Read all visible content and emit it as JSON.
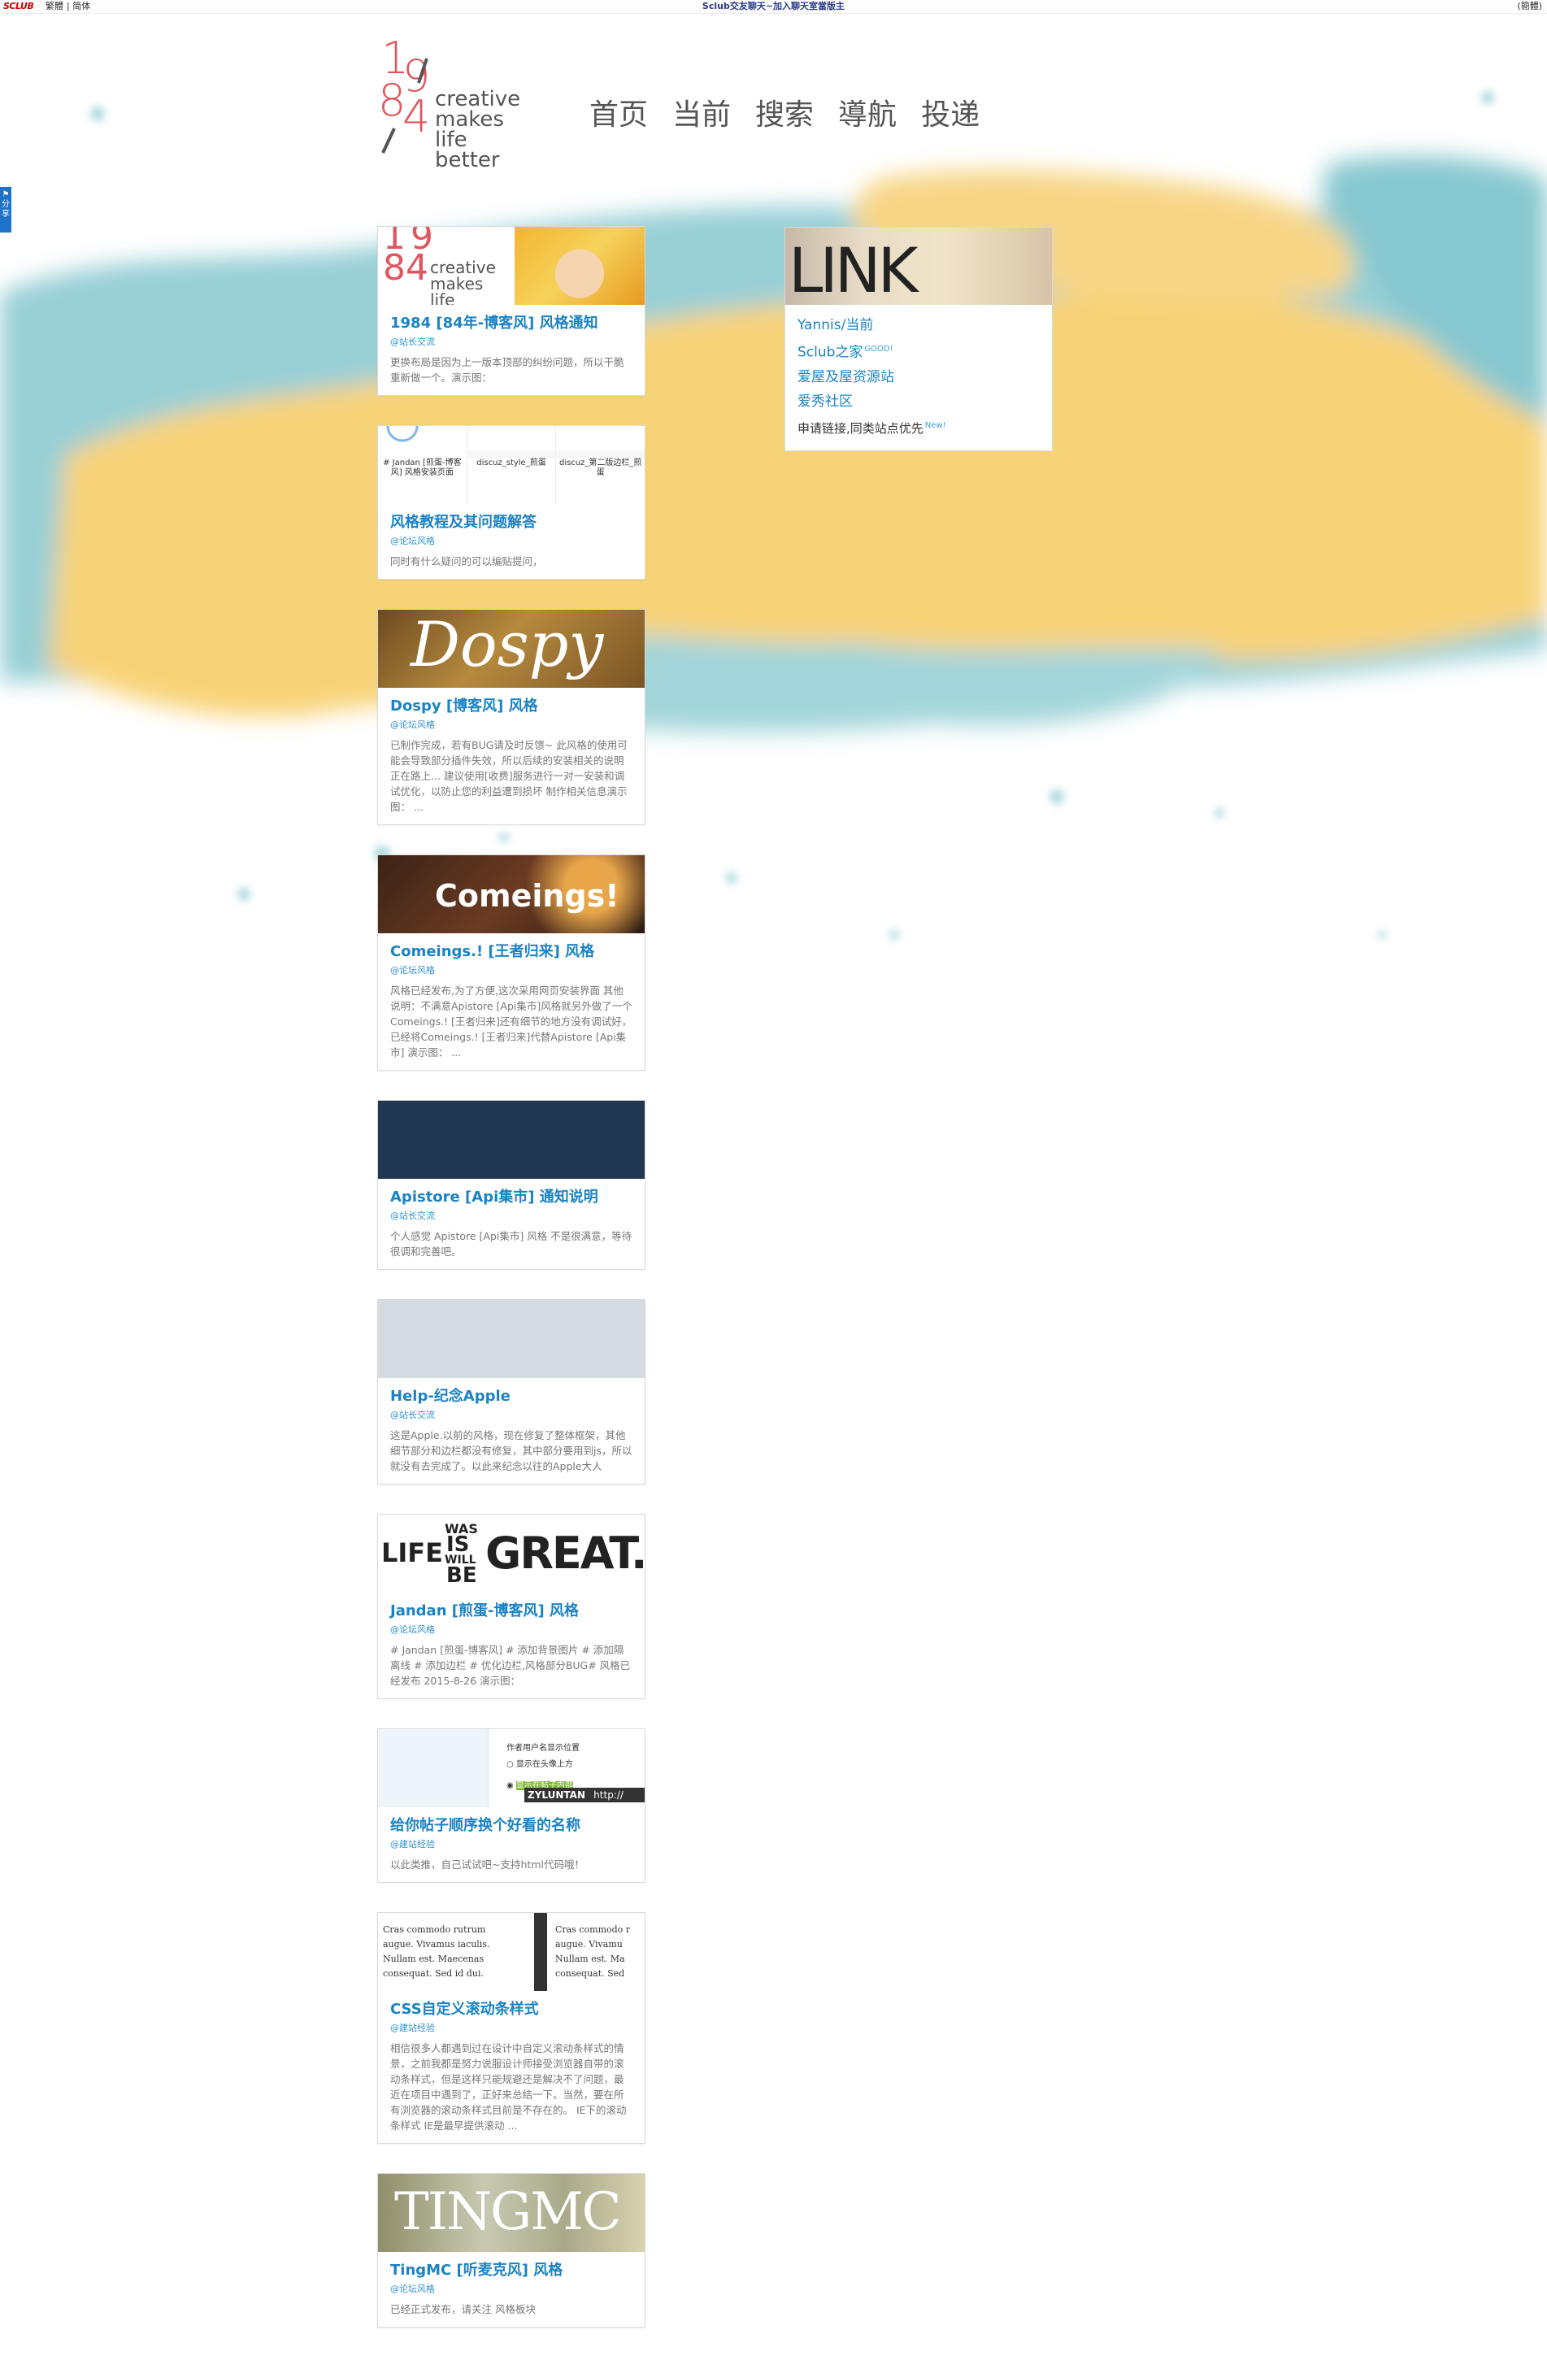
{
  "topbar": {
    "brand": "SCLUB",
    "lang_traditional": "繁體",
    "lang_simplified": "简体",
    "notice": "Sclub交友聊天~加入聊天室當版主",
    "right": "(簡體)"
  },
  "share": {
    "label": "分享"
  },
  "logo": {
    "digits": [
      "1",
      "9",
      "8",
      "4"
    ],
    "tagline": [
      "creative",
      "makes",
      "life",
      "better"
    ]
  },
  "nav": [
    "首页",
    "当前",
    "搜索",
    "導航",
    "投递"
  ],
  "cards": [
    {
      "thumb": "1984",
      "title": "1984 [84年-博客风] 风格通知",
      "category": "@站长交流",
      "desc": "更换布局是因为上一版本顶部的纠纷问题，所以干脆重新做一个。演示图："
    },
    {
      "thumb": "gallery",
      "gallery_items": [
        "# Jandan [煎蛋-博客风] 风格安装页面",
        "discuz_style_煎蛋",
        "discuz_第二版边栏_煎蛋"
      ],
      "title": "风格教程及其问题解答",
      "category": "@论坛风格",
      "desc": "同时有什么疑问的可以编贴提问，"
    },
    {
      "thumb": "dospy",
      "thumb_text": "Dospy",
      "title": "Dospy [博客风] 风格",
      "category": "@论坛风格",
      "desc": "已制作完成，若有BUG请及时反馈~ 此风格的使用可能会导致部分插件失效，所以后续的安装相关的说明正在路上... 建议使用[收费]服务进行一对一安装和调试优化，以防止您的利益遭到损坏 制作相关信息演示图： ..."
    },
    {
      "thumb": "comeings",
      "thumb_text": "Comeings!",
      "title": "Comeings.! [王者归来] 风格",
      "category": "@论坛风格",
      "desc": "风格已经发布,为了方便,这次采用网页安装界面 其他说明：不满意Apistore [Api集市]风格就另外做了一个Comeings.! [王者归来]还有细节的地方没有调试好，已经将Comeings.! [王者归来]代替Apistore [Api集市] 演示图： ..."
    },
    {
      "thumb": "navy",
      "title": "Apistore [Api集市] 通知说明",
      "category": "@站长交流",
      "desc": "个人感觉 Apistore [Api集市] 风格 不是很满意，等待很调和完善吧。"
    },
    {
      "thumb": "grey",
      "title": "Help-纪念Apple",
      "category": "@站长交流",
      "desc": "这是Apple.以前的风格，现在修复了整体框架，其他细节部分和边栏都没有修复，其中部分要用到js，所以就没有去完成了。以此来纪念以往的Apple大人"
    },
    {
      "thumb": "great",
      "thumb_words": [
        "LIFE",
        "WAS",
        "IS",
        "WILL",
        "BE",
        "GREAT."
      ],
      "title": "Jandan [煎蛋-博客风] 风格",
      "category": "@论坛风格",
      "desc": "# Jandan [煎蛋-博客风] # 添加背景图片 # 添加隔离线 # 添加边栏 # 优化边栏,风格部分BUG# 风格已经发布 2015-8-26 演示图："
    },
    {
      "thumb": "settings",
      "thumb_lines": [
        "作者用户名显示位置",
        "显示在头像上方",
        "显示在帖子内部",
        "ZYLUNTAN",
        "http://"
      ],
      "title": "给你帖子顺序换个好看的名称",
      "category": "@建站经验",
      "desc": "以此类推，自己试试吧~支持html代码哦！"
    },
    {
      "thumb": "code",
      "thumb_code": [
        "Cras commodo rutrum",
        "augue. Vivamus iaculis.",
        "Nullam est. Maecenas",
        "consequat. Sed id dui."
      ],
      "thumb_code_b": [
        "Cras commodo r",
        "augue. Vivamu",
        "Nullam est. Ma",
        "consequat. Sed"
      ],
      "title": "CSS自定义滚动条样式",
      "category": "@建站经验",
      "desc": "相信很多人都遇到过在设计中自定义滚动条样式的情景，之前我都是努力说服设计师接受浏览器自带的滚动条样式，但是这样只能规避还是解决不了问题，最近在项目中遇到了，正好来总结一下。当然，要在所有浏览器的滚动条样式目前是不存在的。 IE下的滚动条样式 IE是最早提供滚动 ..."
    },
    {
      "thumb": "tingmc",
      "thumb_text": "TINGMC",
      "title": "TingMC [听麦克风] 风格",
      "category": "@论坛风格",
      "desc": "已经正式发布，请关注 风格板块"
    }
  ],
  "links": {
    "thumb_text": "LINK",
    "items": [
      {
        "label": "Yannis/当前",
        "badge": ""
      },
      {
        "label": "Sclub之家",
        "badge": "GOOD!"
      },
      {
        "label": "爱屋及屋资源站",
        "badge": ""
      },
      {
        "label": "爱秀社区",
        "badge": ""
      }
    ],
    "note": "申请链接,同类站点优先",
    "note_badge": "New!"
  },
  "colors": {
    "accent": "#1a83c5",
    "logo_red": "#e0565e",
    "paint_yellow": "#f7cf6a",
    "paint_teal": "#8dcbd2"
  }
}
